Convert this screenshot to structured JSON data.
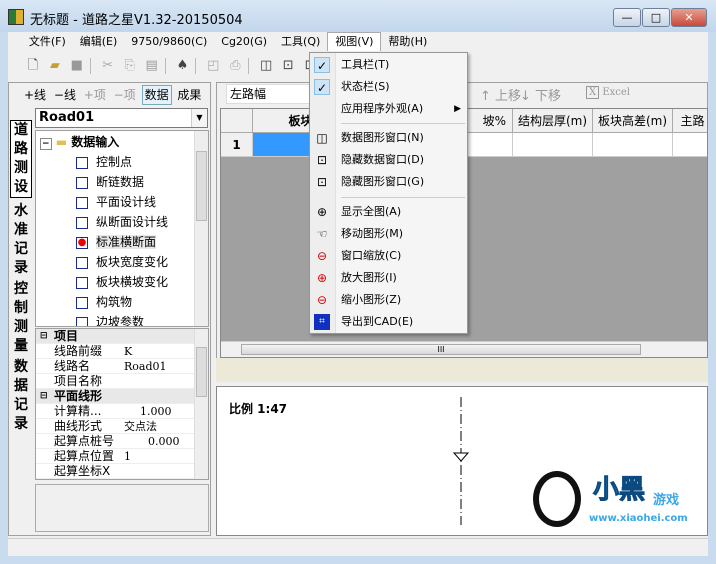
{
  "window": {
    "title": "无标题 - 道路之星V1.32-20150504",
    "minimize": "—",
    "maximize": "□",
    "close": "✕"
  },
  "menubar": [
    "文件(F)",
    "编辑(E)",
    "9750/9860(C)",
    "Cg20(G)",
    "工具(Q)",
    "视图(V)",
    "帮助(H)"
  ],
  "view_menu": {
    "items": [
      {
        "label": "工具栏(T)",
        "icon": "check-icon",
        "checked": true
      },
      {
        "label": "状态栏(S)",
        "icon": "check-icon",
        "checked": true
      },
      {
        "label": "应用程序外观(A)",
        "submenu": true
      },
      {
        "label": "数据图形窗口(N)",
        "icon": "layout-icon"
      },
      {
        "label": "隐藏数据窗口(D)",
        "icon": "hide-data-icon"
      },
      {
        "label": "隐藏图形窗口(G)",
        "icon": "hide-graph-icon"
      },
      {
        "label": "显示全图(A)",
        "icon": "zoom-extents-icon"
      },
      {
        "label": "移动图形(M)",
        "icon": "pan-hand-icon"
      },
      {
        "label": "窗口缩放(C)",
        "icon": "zoom-window-icon"
      },
      {
        "label": "放大图形(I)",
        "icon": "zoom-in-icon"
      },
      {
        "label": "缩小图形(Z)",
        "icon": "zoom-out-icon"
      },
      {
        "label": "导出到CAD(E)",
        "icon": "cad-export-icon"
      }
    ]
  },
  "left": {
    "toolbar": {
      "add_line": "+线",
      "del_line": "−线",
      "add_item": "+项",
      "del_item": "−项",
      "data": "数据",
      "result": "成果"
    },
    "road_select": "Road01",
    "vtabs": [
      "道路测设",
      "水准记录",
      "控制测量",
      "数据记录"
    ],
    "tree": {
      "root": "数据输入",
      "items": [
        "控制点",
        "断链数据",
        "平面设计线",
        "纵断面设计线",
        "标准横断面",
        "板块宽度变化",
        "板块横坡变化",
        "构筑物",
        "边坡参数"
      ],
      "selected": "标准横断面"
    },
    "props": [
      {
        "cat": "项目"
      },
      {
        "k": "线路前缀",
        "v": "K"
      },
      {
        "k": "线路名",
        "v": "Road01"
      },
      {
        "k": "项目名称",
        "v": ""
      },
      {
        "cat": "平面线形"
      },
      {
        "k": "计算精...",
        "v": "1.000"
      },
      {
        "k": "曲线形式",
        "v": "交点法"
      },
      {
        "k": "起算点桩号",
        "v": "0.000"
      },
      {
        "k": "起算点位置",
        "v": "1"
      },
      {
        "k": "起算坐标X",
        "v": ""
      }
    ]
  },
  "right": {
    "side_select": "左路幅",
    "up": "上移",
    "down": "下移",
    "excel": "Excel",
    "columns": [
      "板块类型",
      "坡%",
      "结构层厚(m)",
      "板块高差(m)",
      "主路"
    ],
    "row_number": "1",
    "scale": "比例 1:47"
  },
  "watermark": {
    "brand": "小黑游戏",
    "url": "www.xiaohei.com"
  },
  "colors": {
    "accent": "#3399ff",
    "menu_check": "#cde4f7"
  }
}
